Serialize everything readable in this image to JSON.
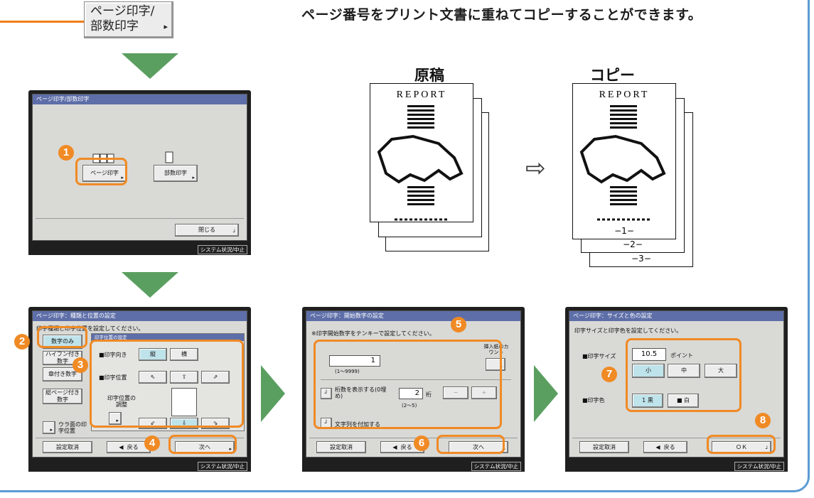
{
  "header": {
    "button_line1": "ページ印字/",
    "button_line2": "部数印字",
    "button_arrow": "▸",
    "description": "ページ番号をプリント文書に重ねてコピーすることができます。"
  },
  "docs": {
    "original_label": "原稿",
    "copy_label": "コピー",
    "report_title": "REPORT",
    "page_numbers": [
      "−1−",
      "−2−",
      "−3−"
    ],
    "arrow": "⇨"
  },
  "screen1": {
    "title": "ページ印字/部数印字",
    "page_print_button": "ページ印字",
    "copy_print_button": "部数印字",
    "close_button": "閉じる",
    "status": "システム状況/中止"
  },
  "screen2": {
    "title": "ページ印字：種類と位置の設定",
    "instruction": "印字種類と印字位置を設定してください。",
    "type_digits_only": "数字のみ",
    "type_hyphen": "ハイフン付き数字",
    "type_chapter": "章付き数字",
    "type_total": "総ページ付き数字",
    "back_position": "ウラ面の印字位置",
    "panel_title": "印字位置の設定",
    "orientation_label": "■印字向き",
    "orientation_vertical": "縦",
    "orientation_horizontal": "横",
    "position_label": "■印字位置",
    "adjust_label": "印字位置の調整",
    "cancel_button": "設定取消",
    "back_button": "戻る",
    "next_button": "次へ",
    "status": "システム状況/中止"
  },
  "screen3": {
    "title": "ページ印字：開始数字の設定",
    "instruction": "※印字開始数字をテンキーで設定してください。",
    "start_value": "1",
    "start_range": "(1〜9999)",
    "insert_count": "挿入紙のカウント",
    "show_digits": "桁数を表示する(0埋め)",
    "digits_value": "2",
    "digits_unit": "桁",
    "digits_range": "(2〜5)",
    "minus": "−",
    "plus": "+",
    "add_text": "文字列を付加する",
    "cancel_button": "設定取消",
    "back_button": "戻る",
    "next_button": "次へ",
    "status": "システム状況/中止"
  },
  "screen4": {
    "title": "ページ印字：サイズと色の設定",
    "instruction": "印字サイズと印字色を設定してください。",
    "size_label": "■印字サイズ",
    "size_value": "10.5",
    "size_unit": "ポイント",
    "size_small": "小",
    "size_medium": "中",
    "size_large": "大",
    "color_label": "■印字色",
    "color_black": "黒",
    "color_white": "白",
    "cancel_button": "設定取消",
    "back_button": "戻る",
    "ok_button": "ＯＫ",
    "status": "システム状況/中止"
  },
  "steps": [
    "1",
    "2",
    "3",
    "4",
    "5",
    "6",
    "7",
    "8"
  ],
  "colors": {
    "accent_orange": "#f08a24",
    "arrow_green": "#5a9f60",
    "frame_blue": "#5b9bd5",
    "title_bar": "#5d6ea8",
    "selected": "#bfe3ea"
  }
}
